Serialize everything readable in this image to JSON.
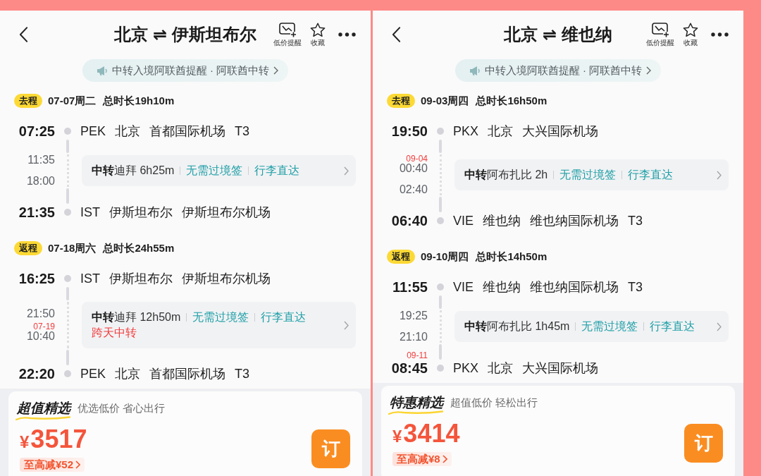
{
  "panels": [
    {
      "header": {
        "title": "北京 ⇌ 伊斯坦布尔",
        "actions": [
          {
            "kind": "price-alert",
            "label": "低价提醒"
          },
          {
            "kind": "favorite",
            "label": "收藏"
          }
        ]
      },
      "notice": {
        "text": "中转入境阿联酋提醒 · 阿联酋中转"
      },
      "legs": [
        {
          "tag": "去程",
          "date": "07-07周二",
          "duration": "总时长19h10m",
          "departure": {
            "time": "07:25",
            "place": "PEK 北京 首都国际机场 T3"
          },
          "transfer": {
            "arrive_time": "11:35",
            "depart_time": "18:00",
            "summary": "**中转**迪拜 6h25m",
            "tags": [
              "无需过境签",
              "行李直达"
            ]
          },
          "arrival": {
            "time": "21:35",
            "place": "IST 伊斯坦布尔 伊斯坦布尔机场"
          }
        },
        {
          "tag": "返程",
          "date": "07-18周六",
          "duration": "总时长24h55m",
          "departure": {
            "time": "16:25",
            "place": "IST 伊斯坦布尔 伊斯坦布尔机场"
          },
          "transfer": {
            "arrive_time": "21:50",
            "depart_date": "07-19",
            "depart_time": "10:40",
            "summary": "**中转**迪拜 12h50m",
            "tags": [
              "无需过境签",
              "行李直达"
            ],
            "note": "跨天中转"
          },
          "arrival": {
            "time": "22:20",
            "place": "PEK 北京 首都国际机场 T3"
          }
        }
      ],
      "deal": {
        "title": "超值精选",
        "subtitle": "优选低价 省心出行",
        "currency": "¥",
        "amount": "3517",
        "discount": "至高减¥52",
        "book": "订"
      }
    },
    {
      "header": {
        "title": "北京 ⇌ 维也纳",
        "actions": [
          {
            "kind": "price-alert",
            "label": "低价提醒"
          },
          {
            "kind": "favorite",
            "label": "收藏"
          }
        ]
      },
      "notice": {
        "text": "中转入境阿联酋提醒 · 阿联酋中转"
      },
      "legs": [
        {
          "tag": "去程",
          "date": "09-03周四",
          "duration": "总时长16h50m",
          "departure": {
            "time": "19:50",
            "place": "PKX 北京 大兴国际机场"
          },
          "transfer": {
            "arrive_date": "09-04",
            "arrive_time": "00:40",
            "depart_time": "02:40",
            "summary": "**中转**阿布扎比 2h",
            "tags": [
              "无需过境签",
              "行李直达"
            ]
          },
          "arrival": {
            "time": "06:40",
            "place": "VIE 维也纳 维也纳国际机场 T3"
          }
        },
        {
          "tag": "返程",
          "date": "09-10周四",
          "duration": "总时长14h50m",
          "departure": {
            "time": "11:55",
            "place": "VIE 维也纳 维也纳国际机场 T3"
          },
          "transfer": {
            "arrive_time": "19:25",
            "depart_time": "21:10",
            "summary": "**中转**阿布扎比 1h45m",
            "tags": [
              "无需过境签",
              "行李直达"
            ]
          },
          "arrival": {
            "date": "09-11",
            "time": "08:45",
            "place": "PKX 北京 大兴国际机场"
          }
        }
      ],
      "deal": {
        "title": "特惠精选",
        "subtitle": "超值低价 轻松出行",
        "currency": "¥",
        "amount": "3414",
        "discount": "至高减¥8",
        "book": "订"
      }
    }
  ]
}
